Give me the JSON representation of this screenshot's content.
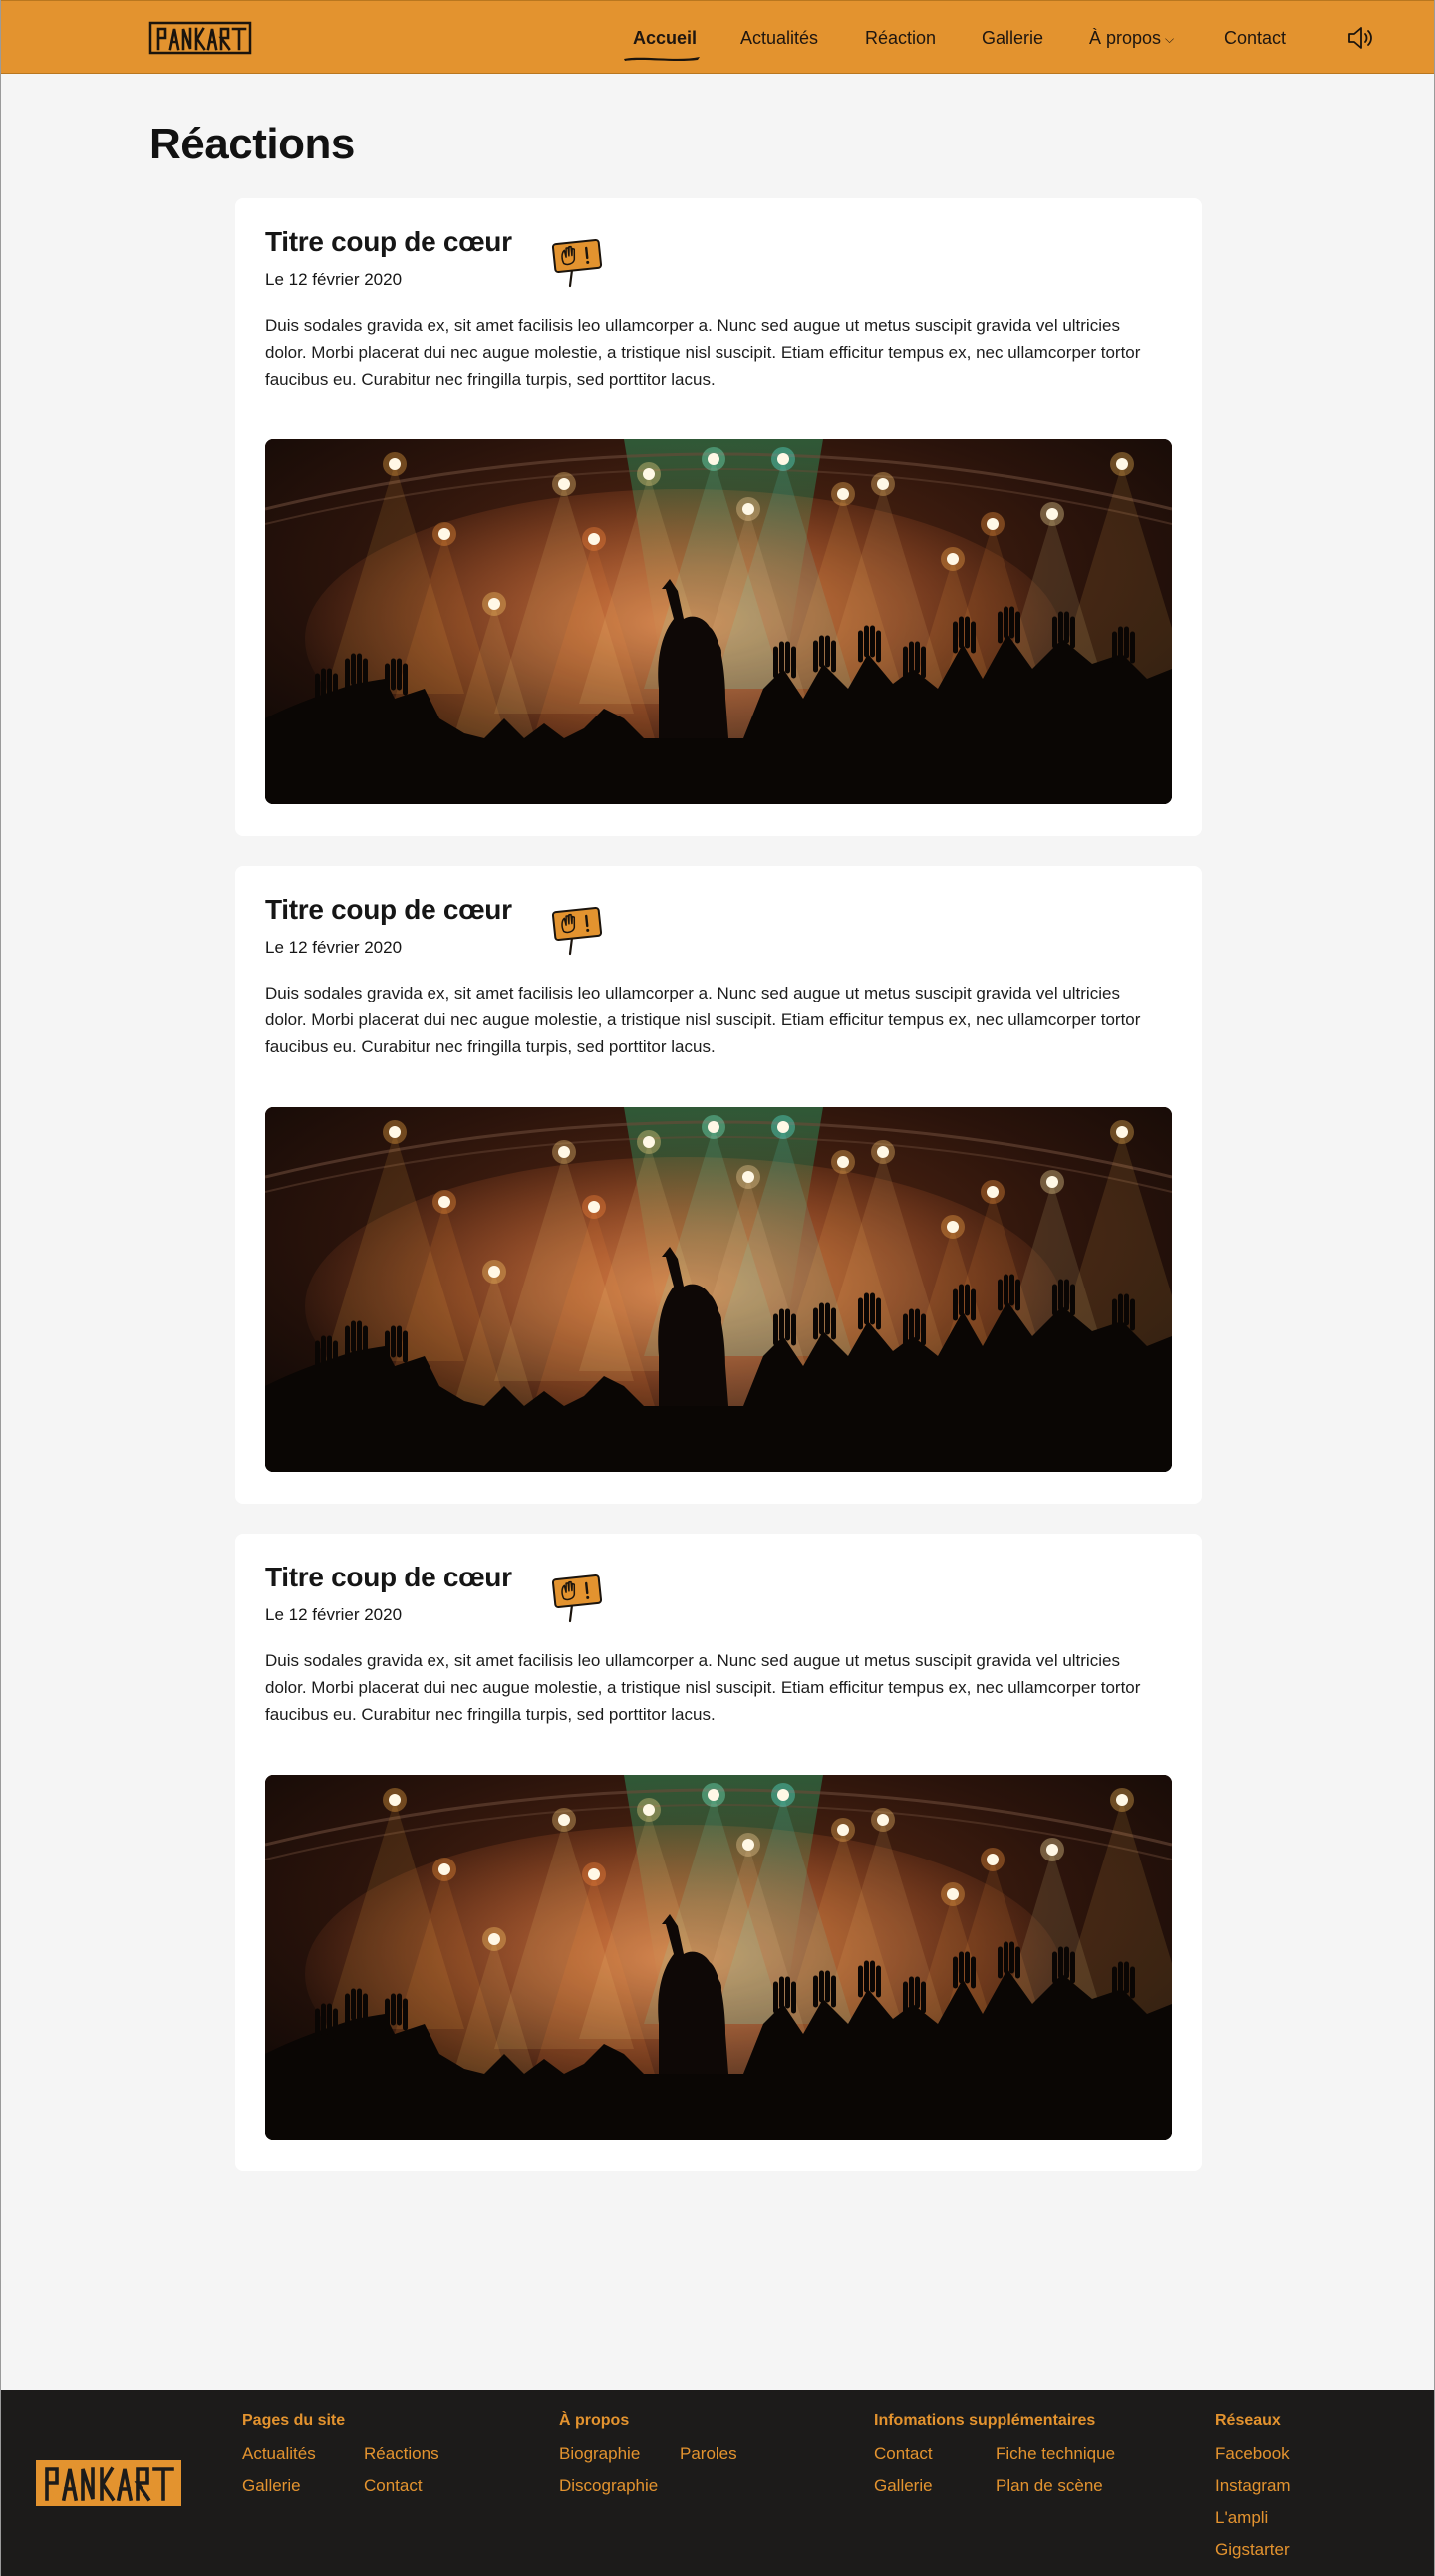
{
  "brand": {
    "name": "PANKART",
    "accent": "#e3932f",
    "footer_bg": "#1c1b1a"
  },
  "nav": {
    "items": [
      {
        "label": "Accueil",
        "active": true
      },
      {
        "label": "Actualités"
      },
      {
        "label": "Réaction"
      },
      {
        "label": "Gallerie"
      },
      {
        "label": "À propos",
        "has_dropdown": true
      },
      {
        "label": "Contact"
      }
    ],
    "sound_icon": "speaker-icon"
  },
  "page": {
    "title": "Réactions"
  },
  "reactions": [
    {
      "title": "Titre coup de cœur",
      "date": "Le 12 février 2020",
      "text": "Duis sodales gravida ex, sit amet facilisis leo ullamcorper a. Nunc sed augue ut metus suscipit gravida vel ultricies dolor. Morbi placerat dui nec augue molestie, a tristique nisl suscipit. Etiam efficitur tempus ex, nec ullamcorper tortor faucibus eu. Curabitur nec fringilla turpis, sed porttitor lacus.",
      "image": "concert-photo"
    },
    {
      "title": "Titre coup de cœur",
      "date": "Le 12 février 2020",
      "text": "Duis sodales gravida ex, sit amet facilisis leo ullamcorper a. Nunc sed augue ut metus suscipit gravida vel ultricies dolor. Morbi placerat dui nec augue molestie, a tristique nisl suscipit. Etiam efficitur tempus ex, nec ullamcorper tortor faucibus eu. Curabitur nec fringilla turpis, sed porttitor lacus.",
      "image": "concert-photo"
    },
    {
      "title": "Titre coup de cœur",
      "date": "Le 12 février 2020",
      "text": "Duis sodales gravida ex, sit amet facilisis leo ullamcorper a. Nunc sed augue ut metus suscipit gravida vel ultricies dolor. Morbi placerat dui nec augue molestie, a tristique nisl suscipit. Etiam efficitur tempus ex, nec ullamcorper tortor faucibus eu. Curabitur nec fringilla turpis, sed porttitor lacus.",
      "image": "concert-photo"
    }
  ],
  "footer": {
    "pages": {
      "title": "Pages du site",
      "links": [
        "Actualités",
        "Réactions",
        "Gallerie",
        "Contact"
      ]
    },
    "about": {
      "title": "À propos",
      "links": [
        "Biographie",
        "Paroles",
        "Discographie"
      ]
    },
    "info": {
      "title": "Infomations supplémentaires",
      "links": [
        "Contact",
        "Fiche technique",
        "Gallerie",
        "Plan de scène"
      ]
    },
    "social": {
      "title": "Réseaux",
      "links": [
        "Facebook",
        "Instagram",
        "L'ampli",
        "Gigstarter"
      ]
    }
  }
}
